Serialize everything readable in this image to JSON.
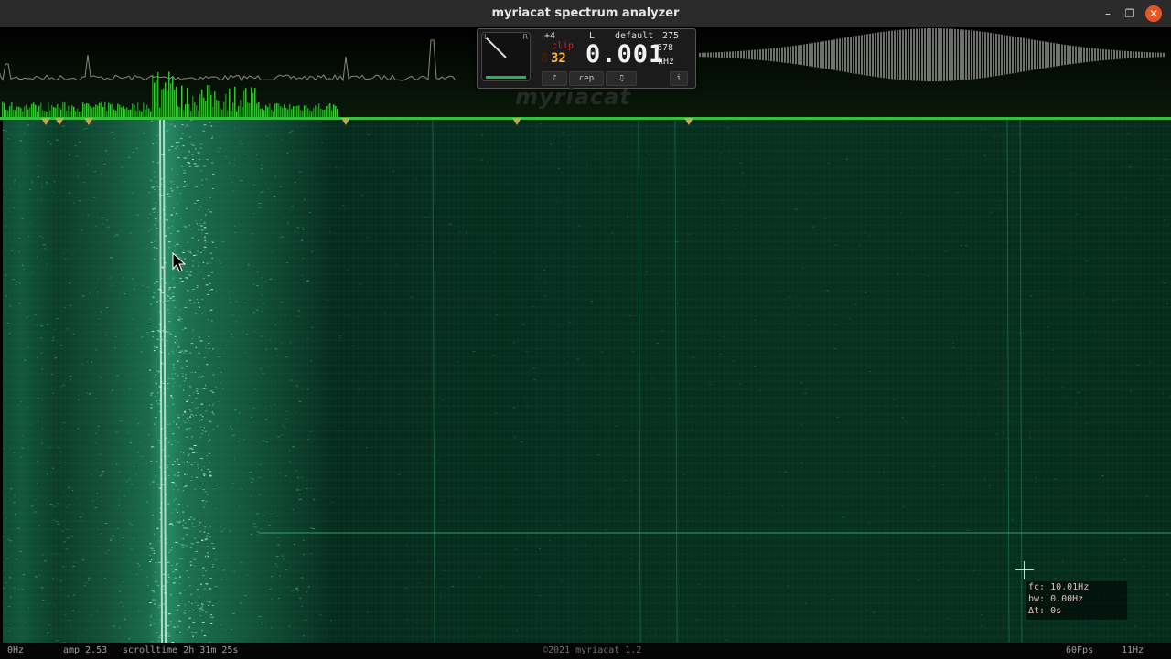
{
  "window": {
    "title": "myriacat spectrum analyzer",
    "controls": {
      "minimize": "–",
      "maximize": "❐",
      "close": "✕"
    }
  },
  "panel": {
    "dial_left_label": "L",
    "dial_right_label": "R",
    "gain": "+4",
    "clip_label": "clip",
    "bits_ghost": "8",
    "bits": "32",
    "channel": "L",
    "preset": "default",
    "value_a": "275",
    "value_b": "678",
    "unit": "kHz",
    "frequency": "0.001",
    "buttons": [
      {
        "label": "♪",
        "icon": "note-icon"
      },
      {
        "label": "cep"
      },
      {
        "label": "♫",
        "icon": "music-icon"
      },
      {
        "label": "i",
        "icon": "info-icon"
      }
    ]
  },
  "logo_text": "myriacat",
  "readout": {
    "fc": "fc: 10.01Hz",
    "bw": "bw: 0.00Hz",
    "dt": "Δt: 0s"
  },
  "status": {
    "left": "0Hz",
    "amp": "amp 2.53",
    "scrolltime": "scrolltime 2h 31m 25s",
    "copyright": "©2021 myriacat 1.2",
    "fps": "60Fps",
    "right": "11Hz"
  },
  "colors": {
    "accent": "#34c03a",
    "marker": "#c9a64a",
    "close": "#e95420",
    "waterfall": "#0f4a34"
  }
}
